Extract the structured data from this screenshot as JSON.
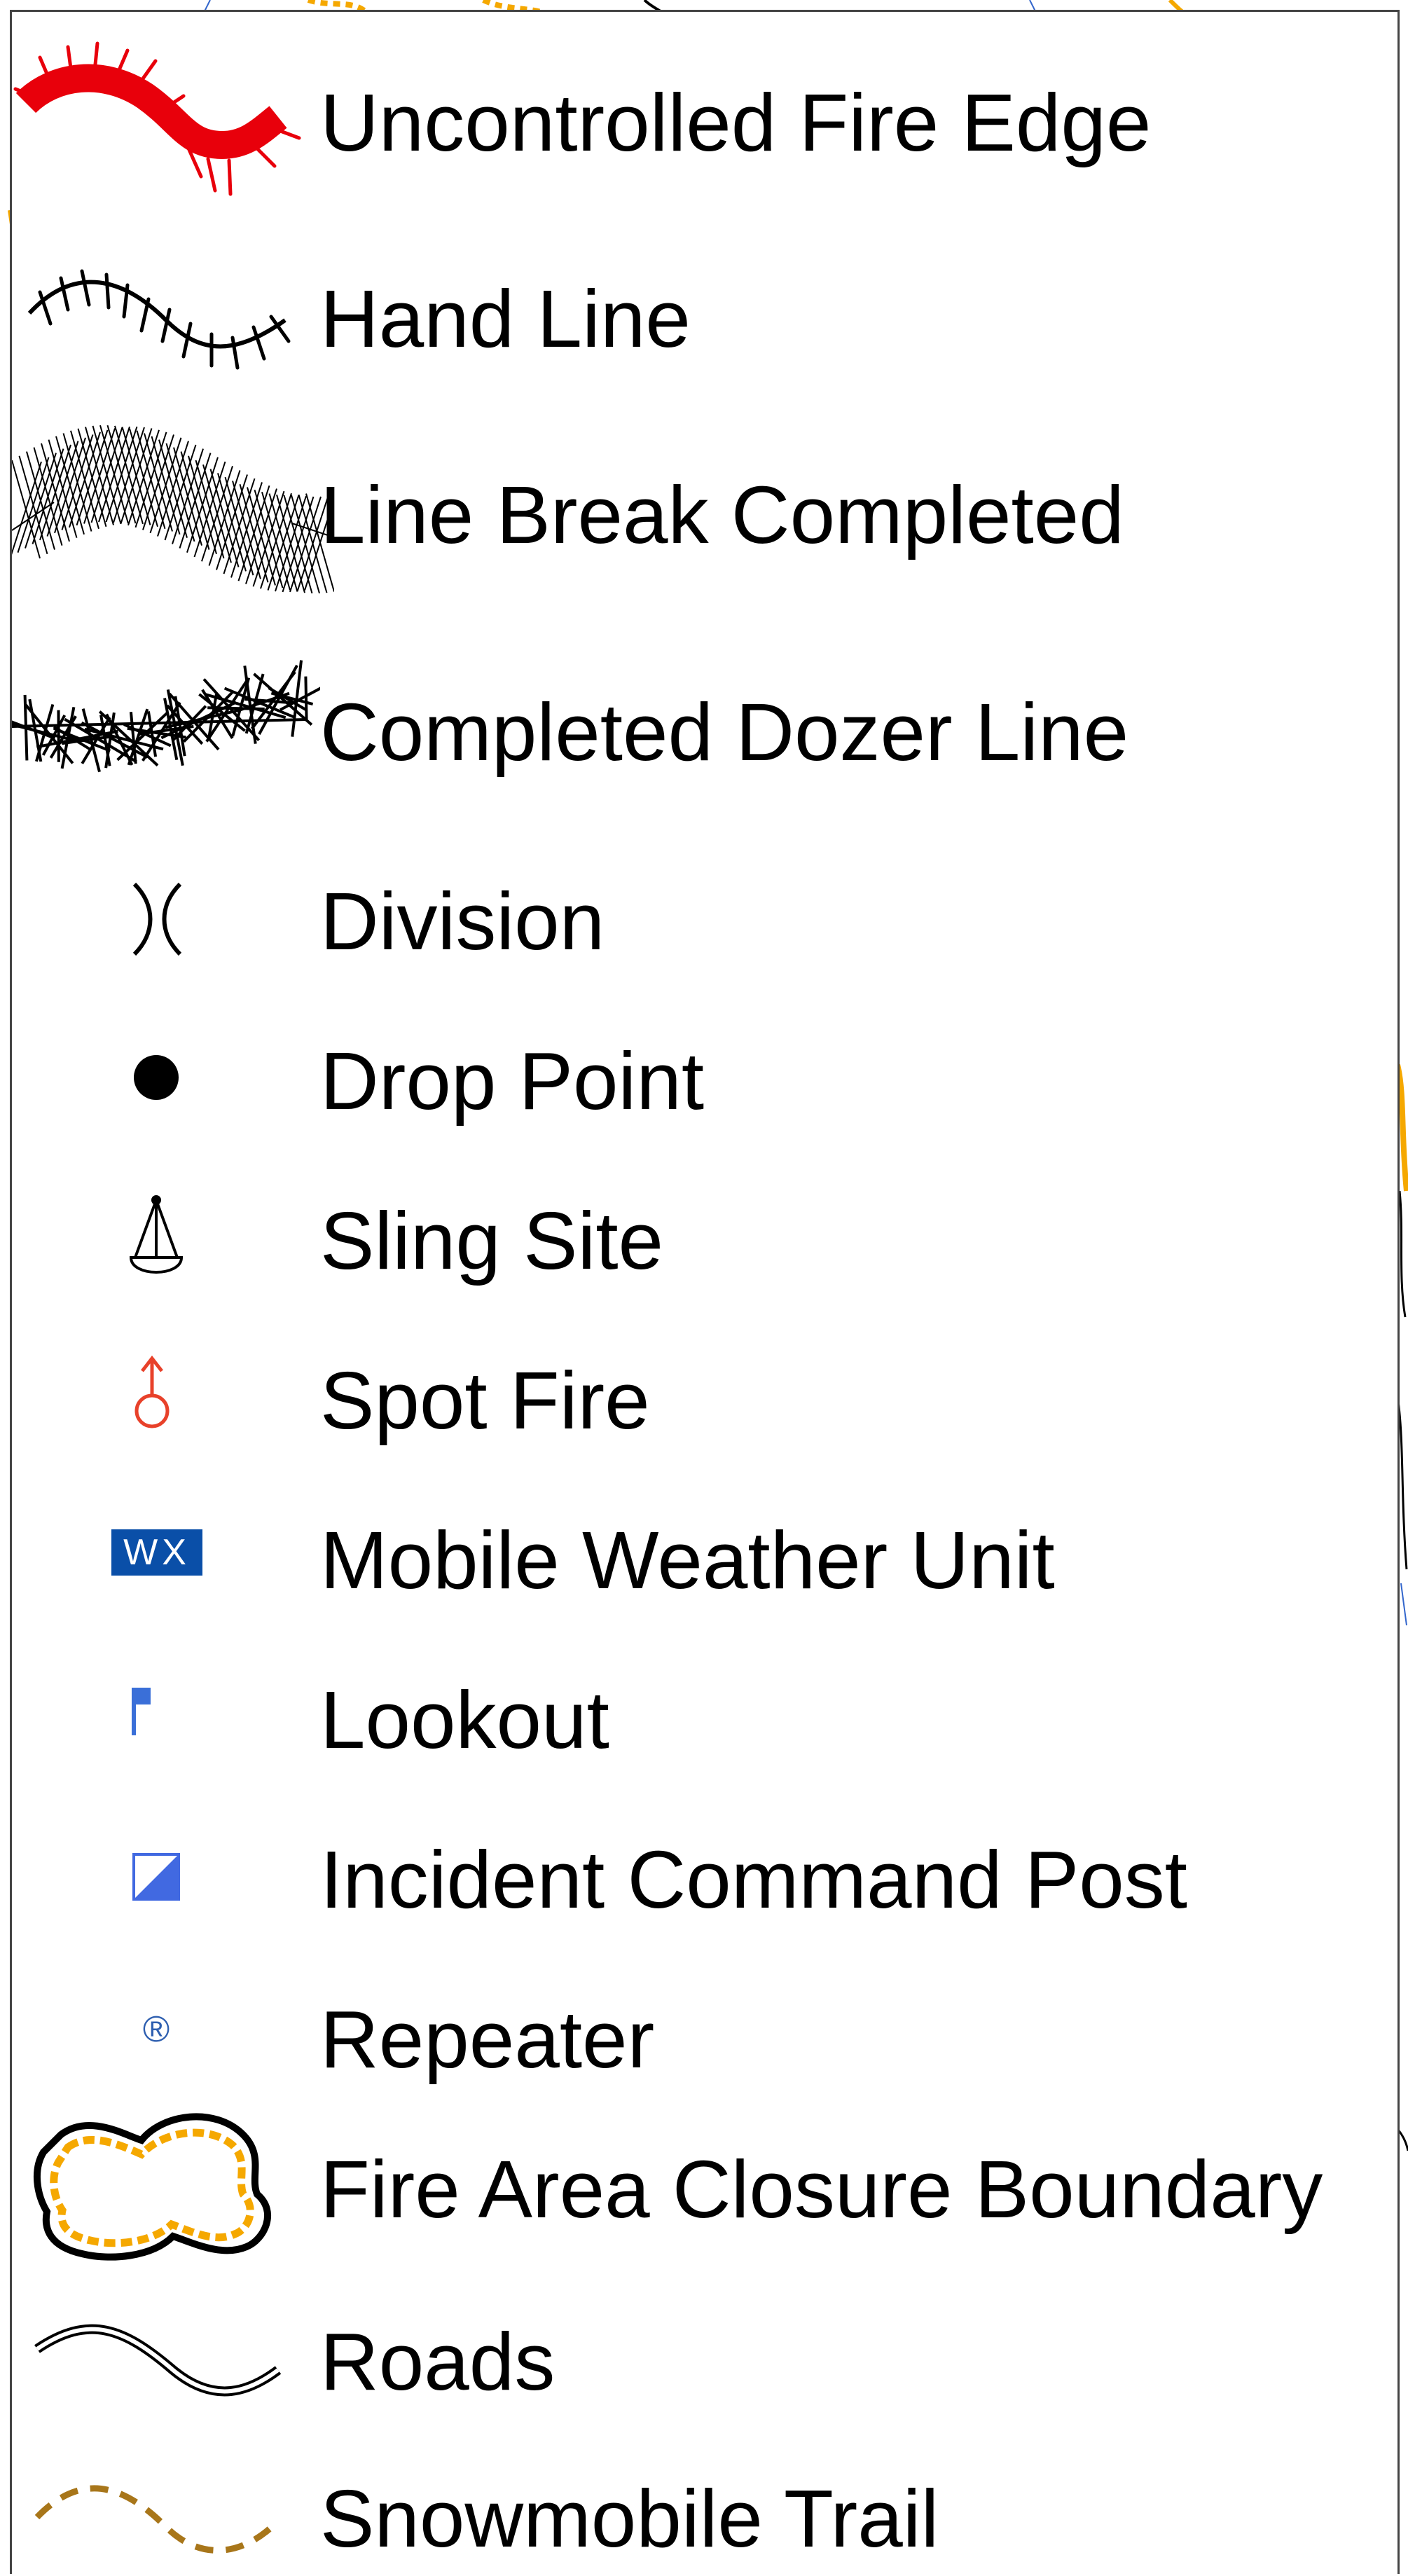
{
  "legend": {
    "items": [
      {
        "label": "Uncontrolled Fire Edge",
        "icon": "uncontrolled-fire-edge-icon",
        "color": "#E8000B"
      },
      {
        "label": "Hand Line",
        "icon": "hand-line-icon",
        "color": "#000000"
      },
      {
        "label": "Line Break Completed",
        "icon": "line-break-completed-icon",
        "color": "#000000"
      },
      {
        "label": "Completed Dozer Line",
        "icon": "completed-dozer-line-icon",
        "color": "#000000"
      },
      {
        "label": "Division",
        "icon": "division-icon",
        "color": "#000000"
      },
      {
        "label": "Drop Point",
        "icon": "drop-point-icon",
        "color": "#000000"
      },
      {
        "label": "Sling Site",
        "icon": "sling-site-icon",
        "color": "#000000"
      },
      {
        "label": "Spot Fire",
        "icon": "spot-fire-icon",
        "color": "#E8412A"
      },
      {
        "label": "Mobile Weather Unit",
        "icon": "mobile-weather-unit-icon",
        "icon_text": "WX",
        "color": "#0A4FA8"
      },
      {
        "label": "Lookout",
        "icon": "lookout-flag-icon",
        "color": "#3A6FD8"
      },
      {
        "label": "Incident Command Post",
        "icon": "incident-command-post-icon",
        "color": "#4169E1"
      },
      {
        "label": "Repeater",
        "icon": "repeater-icon",
        "icon_text": "®",
        "color": "#2E5FB0"
      },
      {
        "label": "Fire Area Closure Boundary",
        "icon": "fire-area-closure-boundary-icon",
        "color": "#F5A800"
      },
      {
        "label": "Roads",
        "icon": "roads-icon",
        "color": "#000000"
      },
      {
        "label": "Snowmobile Trail",
        "icon": "snowmobile-trail-icon",
        "color": "#A8761A"
      }
    ]
  }
}
